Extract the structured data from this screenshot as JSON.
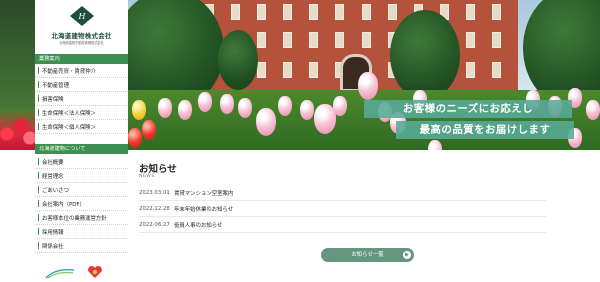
{
  "brand": {
    "name": "北海道建物株式会社",
    "tagline": "北海道建物不動産管理株式会社",
    "colors": {
      "primary": "#3e8f52",
      "logo": "#1f4f37",
      "banner": "#56aa96",
      "button": "#66967f"
    }
  },
  "sidebar": {
    "section1_title": "業務案内",
    "section1_items": [
      {
        "label": "不動産売買・賃貸仲介"
      },
      {
        "label": "不動産管理"
      },
      {
        "label": "損害保険"
      },
      {
        "label": "生命保険＜法人保険＞"
      },
      {
        "label": "生命保険＜個人保険＞"
      }
    ],
    "section2_title": "北海道建物について",
    "section2_items": [
      {
        "label": "会社概要"
      },
      {
        "label": "経営理念"
      },
      {
        "label": "ごあいさつ"
      },
      {
        "label": "会社案内（PDF）"
      },
      {
        "label": "お客様本位の業務運営方針"
      },
      {
        "label": "採用情報"
      },
      {
        "label": "関係会社"
      }
    ]
  },
  "hero": {
    "line1": "お客様のニーズにお応えし",
    "line2": "最高の品質をお届けします"
  },
  "news": {
    "title": "お知らせ",
    "subtitle": "NEWS",
    "items": [
      {
        "date": "2023.03.01",
        "text": "賃貸マンション空室案内"
      },
      {
        "date": "2022.12.28",
        "text": "年末年始休業のお知らせ"
      },
      {
        "date": "2022.06.27",
        "text": "役員人事のお知らせ"
      }
    ],
    "more_label": "お知らせ一覧",
    "more_icon": "arrow-right-icon"
  }
}
